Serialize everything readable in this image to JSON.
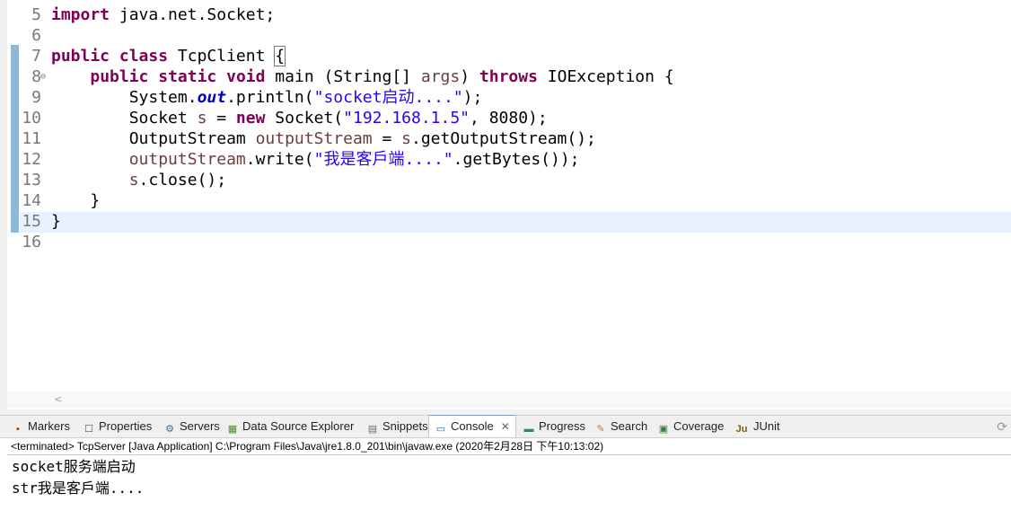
{
  "editor": {
    "lines": [
      {
        "num": "5",
        "code": "<span class=\"kw\">import</span> java.net.Socket;"
      },
      {
        "num": "6",
        "code": ""
      },
      {
        "num": "7",
        "code": "<span class=\"kw\">public</span> <span class=\"kw\">class</span> TcpClient <span class=\"cursor-brace\">{</span>"
      },
      {
        "num": "8",
        "code": "    <span class=\"kw\">public</span> <span class=\"kw\">static</span> <span class=\"kw\">void</span> main (String[] <span class=\"var\">args</span>) <span class=\"kw\">throws</span> IOException {"
      },
      {
        "num": "9",
        "code": "        System.<span class=\"fld\">out</span>.println(<span class=\"str\">\"socket启动....\"</span>);"
      },
      {
        "num": "10",
        "code": "        Socket <span class=\"var\">s</span> = <span class=\"kw\">new</span> Socket(<span class=\"str\">\"192.168.1.5\"</span>, 8080);"
      },
      {
        "num": "11",
        "code": "        OutputStream <span class=\"var\">outputStream</span> = <span class=\"var\">s</span>.getOutputStream();"
      },
      {
        "num": "12",
        "code": "        <span class=\"var\">outputStream</span>.write(<span class=\"str\">\"我是客戶端....\"</span>.getBytes());"
      },
      {
        "num": "13",
        "code": "        <span class=\"var\">s</span>.close();"
      },
      {
        "num": "14",
        "code": "    }"
      },
      {
        "num": "15",
        "code": "}"
      },
      {
        "num": "16",
        "code": ""
      }
    ],
    "fold_marker": "⊖",
    "hscroll_arrow": "<"
  },
  "tabs": [
    {
      "label": "Markers",
      "icon": "markers-icon",
      "glyph": "▪",
      "color": "#8b4513"
    },
    {
      "label": "Properties",
      "icon": "properties-icon",
      "glyph": "☐",
      "color": "#555555"
    },
    {
      "label": "Servers",
      "icon": "servers-icon",
      "glyph": "⚙",
      "color": "#3a6ea5"
    },
    {
      "label": "Data Source Explorer",
      "icon": "data-source-icon",
      "glyph": "▦",
      "color": "#4a8a2a"
    },
    {
      "label": "Snippets",
      "icon": "snippets-icon",
      "glyph": "▤",
      "color": "#6b6b6b"
    },
    {
      "label": "Console",
      "icon": "console-icon",
      "glyph": "▭",
      "color": "#2b5fa8",
      "active": true,
      "close": "✕"
    },
    {
      "label": "Progress",
      "icon": "progress-icon",
      "glyph": "▬",
      "color": "#2e8b57"
    },
    {
      "label": "Search",
      "icon": "search-icon",
      "glyph": "✎",
      "color": "#c08020"
    },
    {
      "label": "Coverage",
      "icon": "coverage-icon",
      "glyph": "▣",
      "color": "#3d7a3d"
    },
    {
      "label": "JUnit",
      "icon": "junit-icon",
      "glyph": "Ju",
      "color": "#7a5a1e"
    }
  ],
  "view_menu_glyph": "⟳",
  "console": {
    "description": "<terminated> TcpServer [Java Application] C:\\Program Files\\Java\\jre1.8.0_201\\bin\\javaw.exe (2020年2月28日 下午10:13:02)",
    "output": [
      "socket服务端启动",
      "str我是客戶端...."
    ]
  }
}
